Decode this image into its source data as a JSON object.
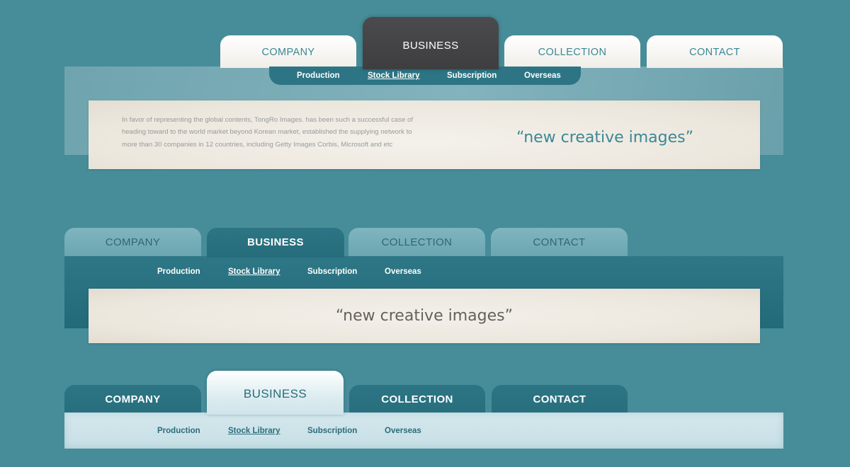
{
  "navs": [
    {
      "tabs": [
        "COMPANY",
        "BUSINESS",
        "COLLECTION",
        "CONTACT"
      ],
      "active_tab": "BUSINESS",
      "subnav": [
        "Production",
        "Stock Library",
        "Subscription",
        "Overseas"
      ],
      "active_subnav": "Stock Library",
      "content_text": "In favor of representing the global contents, TongRo Images. has been such a successful case of heading toward to the world market beyond Korean market, established the supplying network to more than 30 companies in 12 countries, including Getty Images Corbis, Microsoft and etc",
      "quote": "“new creative images”"
    },
    {
      "tabs": [
        "COMPANY",
        "BUSINESS",
        "COLLECTION",
        "CONTACT"
      ],
      "active_tab": "BUSINESS",
      "subnav": [
        "Production",
        "Stock Library",
        "Subscription",
        "Overseas"
      ],
      "active_subnav": "Stock Library",
      "quote": "“new creative images”"
    },
    {
      "tabs": [
        "COMPANY",
        "BUSINESS",
        "COLLECTION",
        "CONTACT"
      ],
      "active_tab": "BUSINESS",
      "subnav": [
        "Production",
        "Stock Library",
        "Subscription",
        "Overseas"
      ],
      "active_subnav": "Stock Library"
    }
  ],
  "colors": {
    "background": "#468d99",
    "accent_teal": "#2d7584",
    "dark_tab": "#444446",
    "content_beige": "#ece7dd",
    "light_panel": "#d5e8ed"
  }
}
